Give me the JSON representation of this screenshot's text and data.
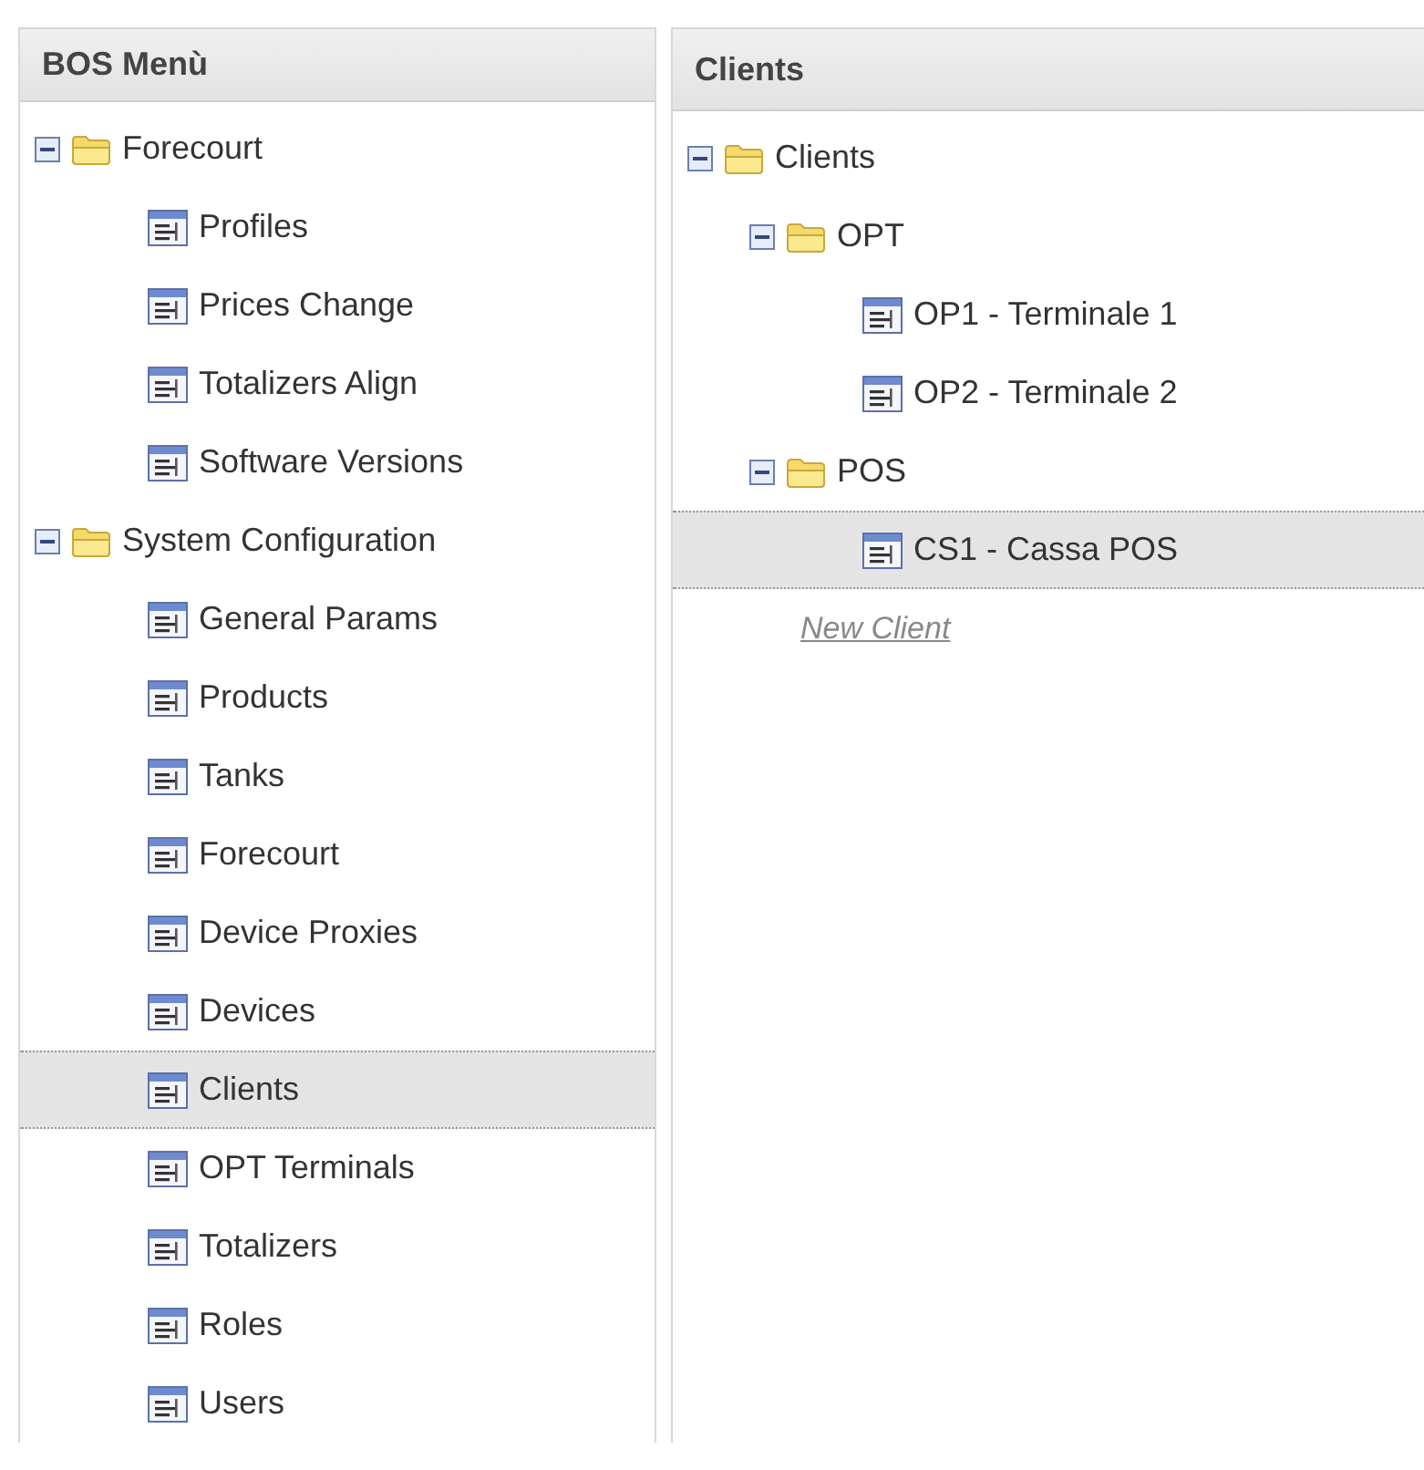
{
  "panels": [
    {
      "title": "BOS Menù",
      "tree": [
        {
          "kind": "folder",
          "label": "Forecourt",
          "expanded": true,
          "children": [
            {
              "kind": "leaf",
              "label": "Profiles",
              "selected": false
            },
            {
              "kind": "leaf",
              "label": "Prices Change",
              "selected": false
            },
            {
              "kind": "leaf",
              "label": "Totalizers Align",
              "selected": false
            },
            {
              "kind": "leaf",
              "label": "Software Versions",
              "selected": false
            }
          ]
        },
        {
          "kind": "folder",
          "label": "System Configuration",
          "expanded": true,
          "children": [
            {
              "kind": "leaf",
              "label": "General Params",
              "selected": false
            },
            {
              "kind": "leaf",
              "label": "Products",
              "selected": false
            },
            {
              "kind": "leaf",
              "label": "Tanks",
              "selected": false
            },
            {
              "kind": "leaf",
              "label": "Forecourt",
              "selected": false
            },
            {
              "kind": "leaf",
              "label": "Device Proxies",
              "selected": false
            },
            {
              "kind": "leaf",
              "label": "Devices",
              "selected": false
            },
            {
              "kind": "leaf",
              "label": "Clients",
              "selected": true
            },
            {
              "kind": "leaf",
              "label": "OPT Terminals",
              "selected": false
            },
            {
              "kind": "leaf",
              "label": "Totalizers",
              "selected": false
            },
            {
              "kind": "leaf",
              "label": "Roles",
              "selected": false
            },
            {
              "kind": "leaf",
              "label": "Users",
              "selected": false
            }
          ]
        }
      ]
    },
    {
      "title": "Clients",
      "tree": [
        {
          "kind": "folder",
          "label": "Clients",
          "expanded": true,
          "children": [
            {
              "kind": "folder",
              "label": "OPT",
              "expanded": true,
              "children": [
                {
                  "kind": "leaf",
                  "label": "OP1 - Terminale 1",
                  "selected": false
                },
                {
                  "kind": "leaf",
                  "label": "OP2 - Terminale 2",
                  "selected": false
                }
              ]
            },
            {
              "kind": "folder",
              "label": "POS",
              "expanded": true,
              "children": [
                {
                  "kind": "leaf",
                  "label": "CS1 - Cassa POS",
                  "selected": true
                }
              ]
            },
            {
              "kind": "add_link",
              "label": "New Client"
            }
          ]
        }
      ]
    }
  ]
}
